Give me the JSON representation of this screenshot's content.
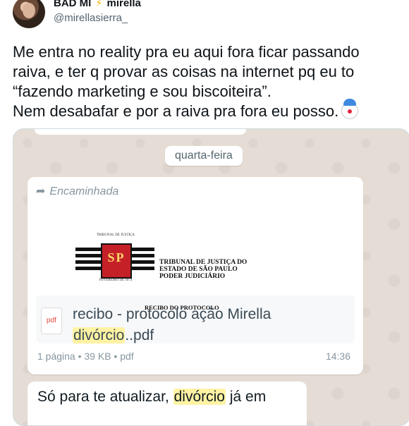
{
  "tweet": {
    "display_name_left": "BAD MI",
    "display_name_right": "mirella",
    "handle": "@mirellasierra_",
    "text": "Me entra no reality pra eu aqui fora ficar passando\nraiva, e ter q provar as coisas na internet pq eu to\n“fazendo marketing e sou biscoiteira”.\nNem desabafar e por a raiva pra fora eu posso."
  },
  "chat": {
    "date_label": "quarta-feira",
    "forwarded_label": "Encaminhada",
    "doc": {
      "court_lines": [
        "TRIBUNAL DE JUSTIÇA DO",
        "ESTADO DE SÃO PAULO",
        "PODER JUDICIÁRIO"
      ],
      "seal_top": "TRIBUNAL DE JUSTIÇA",
      "seal_letters": "SP",
      "seal_bottom": "FEVEREIRO DE 1874",
      "recibo_heading": "RECIBO DO PROTOCOLO",
      "file_icon_label": "pdf",
      "filename_prefix": "recibo - protocolo ação Mirella",
      "filename_highlight": "divórcio",
      "filename_suffix": "..pdf",
      "meta": "1 página • 39 KB • pdf",
      "time": "14:36"
    },
    "message2": {
      "prefix": "Só para te atualizar, ",
      "highlight": "divórcio",
      "suffix": " já em"
    }
  },
  "colors": {
    "chat_background": "#e5ddd5",
    "highlight": "#fff3a3",
    "meta_text": "#8696a0"
  },
  "icons": {
    "verified_like": "lightning-bolt-icon",
    "emoji": "clown-face-icon",
    "forward": "forward-arrow-icon",
    "file": "pdf-file-icon"
  }
}
